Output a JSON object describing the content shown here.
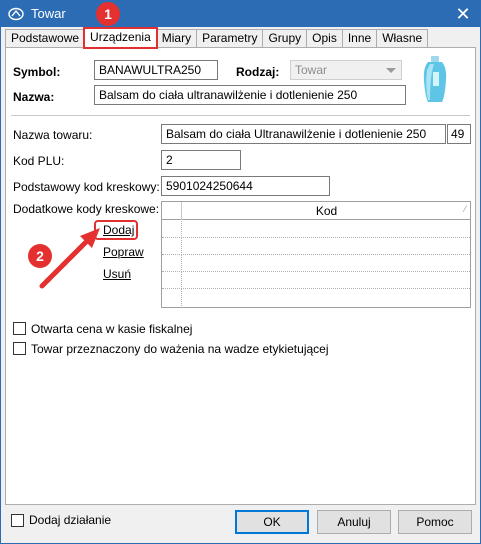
{
  "window": {
    "title": "Towar",
    "app_icon": "app-logo-icon",
    "close_icon": "close-icon"
  },
  "tabs": [
    {
      "label": "Podstawowe"
    },
    {
      "label": "Urządzenia"
    },
    {
      "label": "Miary"
    },
    {
      "label": "Parametry"
    },
    {
      "label": "Grupy"
    },
    {
      "label": "Opis"
    },
    {
      "label": "Inne"
    },
    {
      "label": "Własne"
    }
  ],
  "active_tab": "Urządzenia",
  "header": {
    "symbol_label": "Symbol:",
    "symbol_value": "BANAWULTRA250",
    "rodzaj_label": "Rodzaj:",
    "rodzaj_value": "Towar",
    "nazwa_label": "Nazwa:",
    "nazwa_value": "Balsam do ciała ultranawilżenie i dotlenienie 250"
  },
  "form": {
    "nazwa_towaru_label": "Nazwa towaru:",
    "nazwa_towaru_value": "Balsam do ciała Ultranawilżenie i dotlenienie 250",
    "nazwa_towaru_count": "49",
    "kod_plu_label": "Kod PLU:",
    "kod_plu_value": "2",
    "kod_kreskowy_label": "Podstawowy kod kreskowy:",
    "kod_kreskowy_value": "5901024250644",
    "dodatkowe_label": "Dodatkowe kody kreskowe:"
  },
  "actions": {
    "dodaj": "Dodaj",
    "popraw": "Popraw",
    "usun": "Usuń"
  },
  "grid": {
    "column_header": "Kod",
    "sort_icon": "sort-indicator-icon",
    "rows": 5
  },
  "checkboxes": {
    "otwarta_cena": "Otwarta cena w kasie fiskalnej",
    "wazenie": "Towar przeznaczony do ważenia na wadze etykietującej"
  },
  "footer": {
    "dodaj_dzialanie": "Dodaj działanie",
    "ok": "OK",
    "anuluj": "Anuluj",
    "pomoc": "Pomoc"
  },
  "markers": {
    "m1": "1",
    "m2": "2"
  },
  "colors": {
    "titlebar": "#2b6cb5",
    "annotation_red": "#e03030"
  }
}
